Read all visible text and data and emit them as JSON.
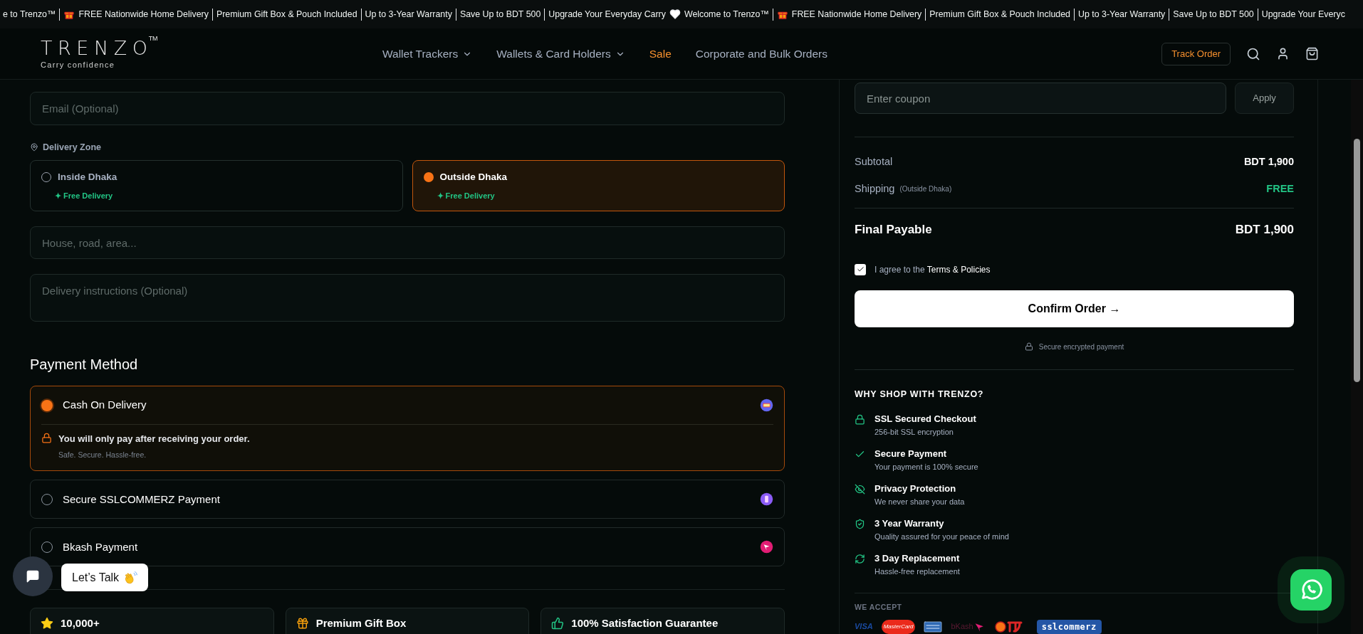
{
  "ticker": [
    {
      "kind": "text",
      "text": "e to Trenzo™"
    },
    {
      "kind": "divider"
    },
    {
      "kind": "gift"
    },
    {
      "kind": "text",
      "text": "FREE Nationwide Home Delivery"
    },
    {
      "kind": "divider"
    },
    {
      "kind": "text",
      "text": "Premium Gift Box & Pouch Included"
    },
    {
      "kind": "divider"
    },
    {
      "kind": "text",
      "text": "Up to 3-Year Warranty"
    },
    {
      "kind": "divider"
    },
    {
      "kind": "text",
      "text": "Save Up to BDT 500"
    },
    {
      "kind": "divider"
    },
    {
      "kind": "text",
      "text": "Upgrade Your Everyday Carry"
    },
    {
      "kind": "heart"
    },
    {
      "kind": "text",
      "text": "Welcome to Trenzo™"
    },
    {
      "kind": "divider"
    },
    {
      "kind": "gift"
    },
    {
      "kind": "text",
      "text": "FREE Nationwide Home Delivery"
    },
    {
      "kind": "divider"
    },
    {
      "kind": "text",
      "text": "Premium Gift Box & Pouch Included"
    },
    {
      "kind": "divider"
    },
    {
      "kind": "text",
      "text": "Up to 3-Year Warranty"
    },
    {
      "kind": "divider"
    },
    {
      "kind": "text",
      "text": "Save Up to BDT 500"
    },
    {
      "kind": "divider"
    },
    {
      "kind": "text",
      "text": "Upgrade Your Everyc"
    }
  ],
  "header": {
    "logo": {
      "name": "TRENZO",
      "trademark": "TM",
      "tagline": "Carry confidence"
    },
    "nav": [
      {
        "label": "Wallet Trackers",
        "dropdown": true,
        "highlighted": false
      },
      {
        "label": "Wallets & Card Holders",
        "dropdown": true,
        "highlighted": false
      },
      {
        "label": "Sale",
        "dropdown": false,
        "highlighted": true
      },
      {
        "label": "Corporate and Bulk Orders",
        "dropdown": false,
        "highlighted": false
      }
    ],
    "track_order": "Track Order"
  },
  "checkout": {
    "email": {
      "placeholder": "Email (Optional)"
    },
    "zone_label": "Delivery Zone",
    "zones": [
      {
        "label": "Inside Dhaka",
        "note": "✦ Free Delivery",
        "selected": false
      },
      {
        "label": "Outside Dhaka",
        "note": "✦ Free Delivery",
        "selected": true
      }
    ],
    "address": {
      "placeholder": "House, road, area..."
    },
    "instructions": {
      "placeholder": "Delivery instructions (Optional)"
    },
    "payment_heading": "Payment Method",
    "payment_methods": [
      {
        "kind": "cod",
        "label": "Cash On Delivery",
        "selected": true,
        "detail_title": "You will only pay after receiving your order.",
        "detail_subtitle": "Safe. Secure. Hassle-free."
      },
      {
        "kind": "ssl",
        "label": "Secure SSLCOMMERZ Payment",
        "selected": false
      },
      {
        "kind": "bkash",
        "label": "Bkash Payment",
        "selected": false
      }
    ],
    "features": [
      {
        "kind": "star",
        "title": "10,000+"
      },
      {
        "kind": "gift",
        "title": "Premium Gift Box"
      },
      {
        "kind": "thumbs",
        "title": "100% Satisfaction Guarantee"
      }
    ]
  },
  "chat": {
    "label": "Let’s Talk"
  },
  "summary": {
    "coupon": {
      "placeholder": "Enter coupon"
    },
    "apply": "Apply",
    "subtotal_label": "Subtotal",
    "subtotal": "BDT 1,900",
    "shipping_label": "Shipping",
    "shipping_note": "(Outside Dhaka)",
    "shipping": "FREE",
    "final_label": "Final Payable",
    "final": "BDT 1,900",
    "agree": {
      "checked": true,
      "text": "I agree to the",
      "link": "Terms & Policies"
    },
    "confirm": "Confirm Order →",
    "secure_note": "Secure encrypted payment",
    "why_heading": "WHY SHOP WITH TRENZO?",
    "benefits": [
      {
        "kind": "lock",
        "title": "SSL Secured Checkout",
        "subtitle": "256-bit SSL encryption"
      },
      {
        "kind": "check",
        "title": "Secure Payment",
        "subtitle": "Your payment is 100% secure"
      },
      {
        "kind": "eye-off",
        "title": "Privacy Protection",
        "subtitle": "We never share your data"
      },
      {
        "kind": "shield",
        "title": "3 Year Warranty",
        "subtitle": "Quality assured for your peace of mind"
      },
      {
        "kind": "refresh",
        "title": "3 Day Replacement",
        "subtitle": "Hassle-free replacement"
      }
    ],
    "accept_label": "WE ACCEPT",
    "logos": [
      {
        "kind": "visa",
        "text": "VISA"
      },
      {
        "kind": "mastercard",
        "text": "MasterCard"
      },
      {
        "kind": "amex"
      },
      {
        "kind": "bkash",
        "text": "bKash"
      },
      {
        "kind": "rocket"
      },
      {
        "kind": "sslcommerz",
        "text": "sslcommerz"
      }
    ]
  }
}
